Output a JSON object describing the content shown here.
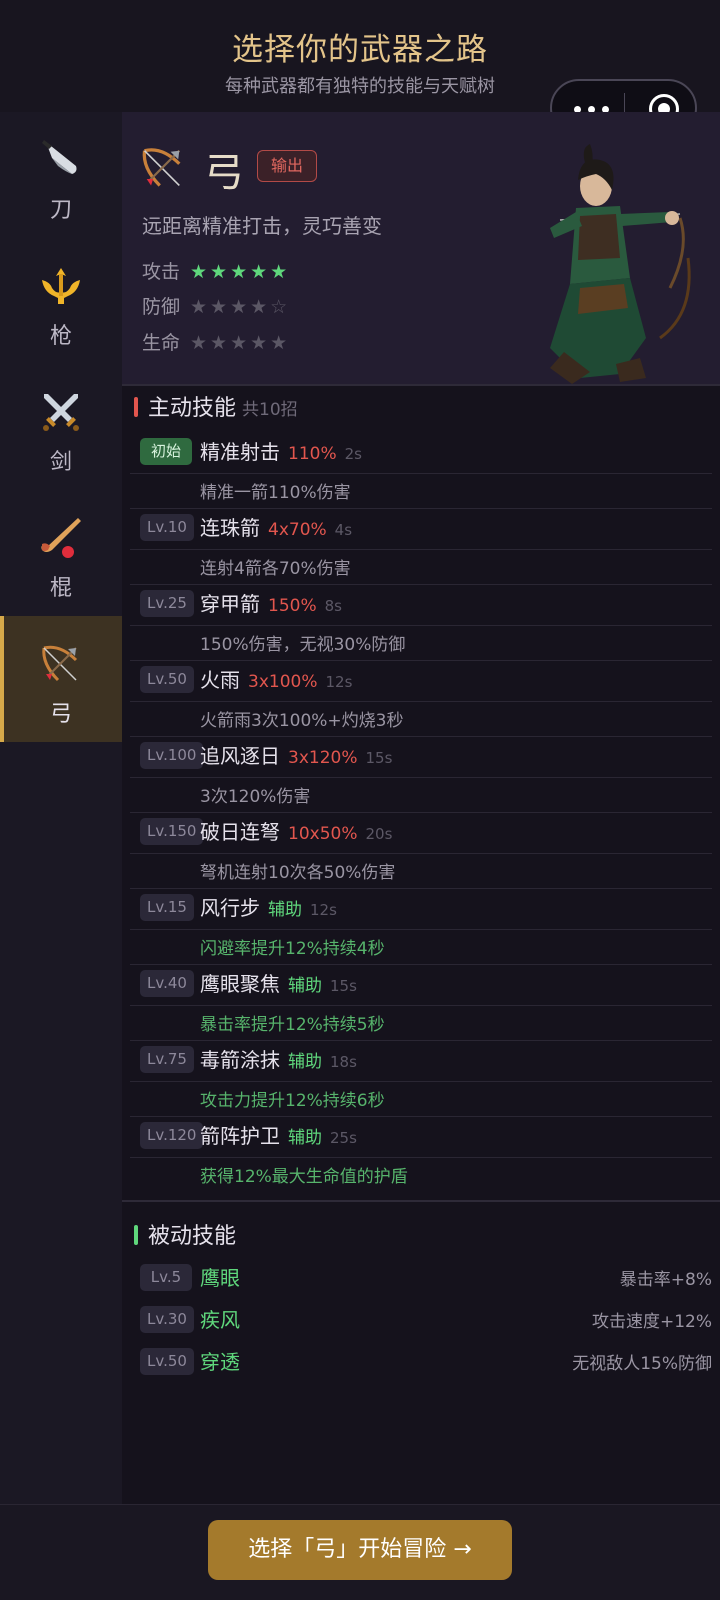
{
  "header": {
    "title": "选择你的武器之路",
    "subtitle": "每种武器都有独特的技能与天赋树"
  },
  "sidebar": {
    "items": [
      {
        "label": "刀",
        "icon": "knife-icon"
      },
      {
        "label": "枪",
        "icon": "trident-icon"
      },
      {
        "label": "剑",
        "icon": "crossed-swords-icon"
      },
      {
        "label": "棍",
        "icon": "hockey-stick-icon"
      },
      {
        "label": "弓",
        "icon": "bow-arrow-icon",
        "active": true
      }
    ]
  },
  "hero": {
    "name": "弓",
    "role": "输出",
    "desc": "远距离精准打击，灵巧善变",
    "stats": [
      {
        "label": "攻击",
        "stars": "★★★★★",
        "rating": 5
      },
      {
        "label": "防御",
        "stars": "★★★★☆",
        "rating": 0
      },
      {
        "label": "生命",
        "stars": "★★★★★",
        "rating": 0
      }
    ]
  },
  "active_skills": {
    "title": "主动技能",
    "count": "共10招",
    "items": [
      {
        "badge": "初始",
        "name": "精准射击",
        "value": "110%",
        "cd": "2s",
        "desc": "精准一箭110%伤害"
      },
      {
        "badge": "Lv.10",
        "name": "连珠箭",
        "value": "4x70%",
        "cd": "4s",
        "desc": "连射4箭各70%伤害"
      },
      {
        "badge": "Lv.25",
        "name": "穿甲箭",
        "value": "150%",
        "cd": "8s",
        "desc": "150%伤害，无视30%防御"
      },
      {
        "badge": "Lv.50",
        "name": "火雨",
        "value": "3x100%",
        "cd": "12s",
        "desc": "火箭雨3次100%+灼烧3秒"
      },
      {
        "badge": "Lv.100",
        "name": "追风逐日",
        "value": "3x120%",
        "cd": "15s",
        "desc": "3次120%伤害"
      },
      {
        "badge": "Lv.150",
        "name": "破日连弩",
        "value": "10x50%",
        "cd": "20s",
        "desc": "弩机连射10次各50%伤害"
      },
      {
        "badge": "Lv.15",
        "name": "风行步",
        "tag": "辅助",
        "cd": "12s",
        "desc": "闪避率提升12%持续4秒"
      },
      {
        "badge": "Lv.40",
        "name": "鹰眼聚焦",
        "tag": "辅助",
        "cd": "15s",
        "desc": "暴击率提升12%持续5秒"
      },
      {
        "badge": "Lv.75",
        "name": "毒箭涂抹",
        "tag": "辅助",
        "cd": "18s",
        "desc": "攻击力提升12%持续6秒"
      },
      {
        "badge": "Lv.120",
        "name": "箭阵护卫",
        "tag": "辅助",
        "cd": "25s",
        "desc": "获得12%最大生命值的护盾"
      }
    ]
  },
  "passive_skills": {
    "title": "被动技能",
    "items": [
      {
        "badge": "Lv.5",
        "name": "鹰眼",
        "effect": "暴击率+8%"
      },
      {
        "badge": "Lv.30",
        "name": "疾风",
        "effect": "攻击速度+12%"
      },
      {
        "badge": "Lv.50",
        "name": "穿透",
        "effect": "无视敌人15%防御"
      }
    ]
  },
  "footer": {
    "cta": "选择「弓」开始冒险 →"
  },
  "colors": {
    "accent_gold": "#a47a2c",
    "damage_red": "#e2564e",
    "support_green": "#5fd77c"
  }
}
